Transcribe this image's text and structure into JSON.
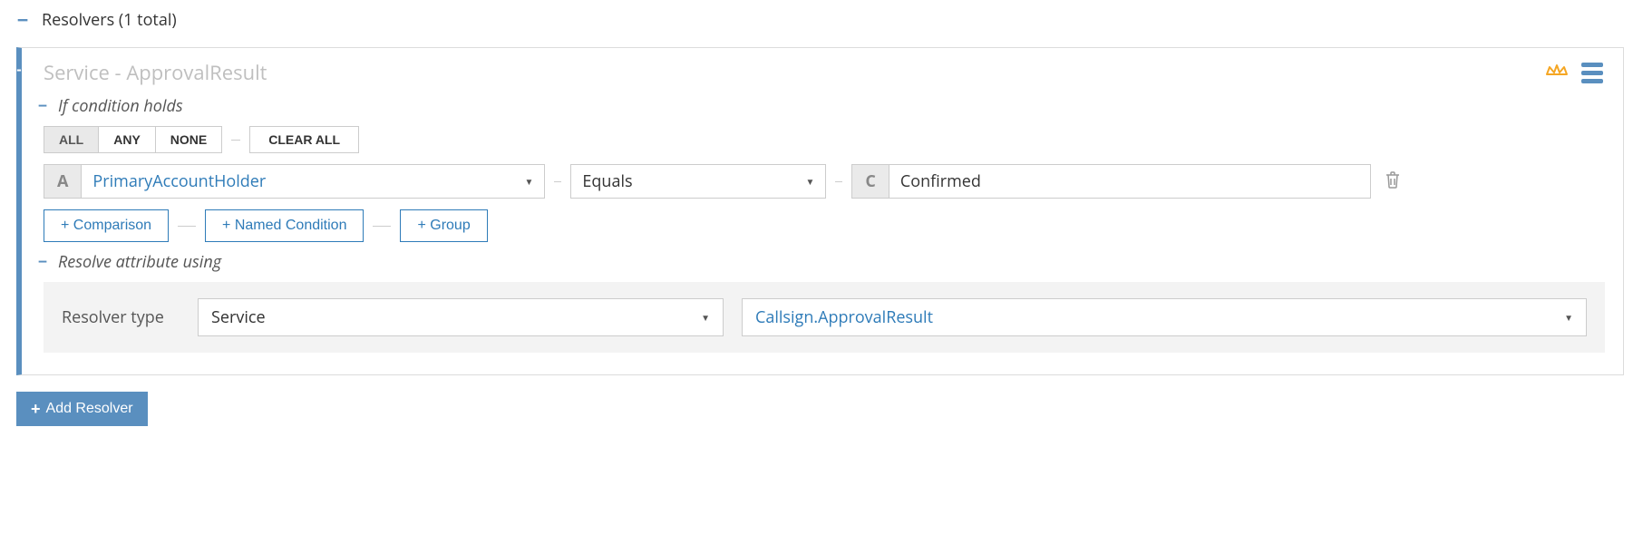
{
  "header": {
    "title": "Resolvers (1 total)"
  },
  "card": {
    "title": "Service - ApprovalResult"
  },
  "condition": {
    "section_label": "If condition holds",
    "modes": {
      "all": "ALL",
      "any": "ANY",
      "none": "NONE"
    },
    "clear": "CLEAR ALL",
    "row": {
      "attr_prefix": "A",
      "attr": "PrimaryAccountHolder",
      "op": "Equals",
      "val_prefix": "C",
      "val": "Confirmed"
    },
    "add": {
      "comparison": "+ Comparison",
      "named": "+ Named Condition",
      "group": "+ Group"
    }
  },
  "resolve": {
    "section_label": "Resolve attribute using",
    "type_label": "Resolver type",
    "type_value": "Service",
    "service_value": "Callsign.ApprovalResult"
  },
  "footer": {
    "add_resolver": "Add Resolver"
  }
}
